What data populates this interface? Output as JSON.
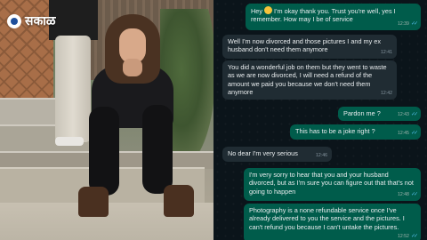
{
  "brand": {
    "name": "सकाळ"
  },
  "chat": {
    "messages": [
      {
        "dir": "out",
        "parts": [
          "Hey",
          "I'm okay thank you. Trust you're well, yes I remember. How may I be of service"
        ],
        "emoji": "smiling-face",
        "time": "12:39",
        "read": true
      },
      {
        "dir": "in",
        "text": "Well I'm now divorced and those pictures I and my ex husband don't need them anymore",
        "time": "12:41"
      },
      {
        "dir": "in",
        "text": "You did a wonderful job on them but they went to waste as we are now divorced, I will need a refund of the amount we paid you because we don't need them anymore",
        "time": "12:42"
      },
      {
        "dir": "out",
        "text": "Pardon me ?",
        "time": "12:43",
        "read": true
      },
      {
        "dir": "out",
        "text": "This has to be a joke right ?",
        "time": "12:45",
        "read": true
      },
      {
        "dir": "in",
        "text": "No dear I'm very serious",
        "time": "12:46"
      },
      {
        "dir": "out",
        "text": "I'm very sorry to hear that you and your husband divorced, but as I'm sure you can figure out that that's not going to happen",
        "time": "12:48",
        "read": true
      },
      {
        "dir": "out",
        "text": "Photography is a none refundable service once I've already delivered to you the service and the pictures. I can't refund you because I can't untake the pictures.",
        "time": "12:52",
        "read": true
      }
    ]
  },
  "colors": {
    "outgoing_bubble": "#005c4b",
    "incoming_bubble": "#202c33",
    "chat_bg": "#0b141a",
    "read_ticks": "#53bdeb",
    "brand_logo": "#1f4f9b"
  },
  "icons": [
    "sakal-logo-icon",
    "read-ticks-icon",
    "smiling-face-emoji-icon"
  ]
}
